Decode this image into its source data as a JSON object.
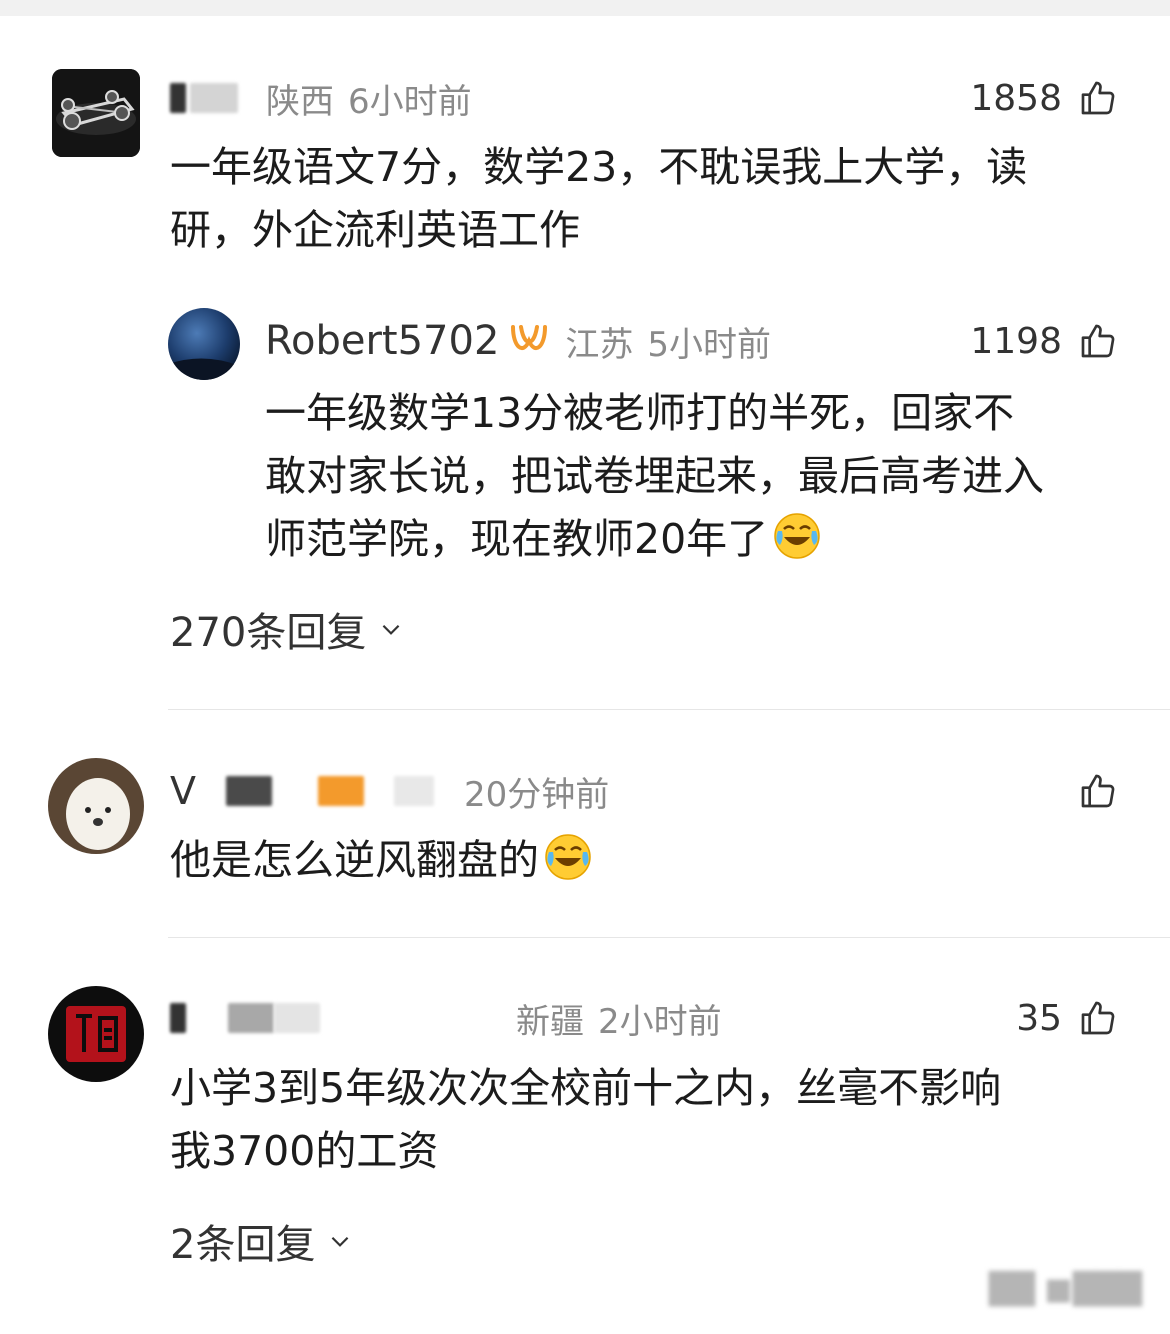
{
  "comments": [
    {
      "user_prefix": "",
      "location": "陕西",
      "time": "6小时前",
      "likes": "1858",
      "text_lines": [
        "一年级语文7分，数学23，不耽误我上大学，读",
        "研，外企流利英语工作"
      ],
      "reply": {
        "user": "Robert5702",
        "location": "江苏",
        "time": "5小时前",
        "likes": "1198",
        "text_lines": [
          "一年级数学13分被老师打的半死，回家不",
          "敢对家长说，把试卷埋起来，最后高考进入",
          "师范学院，现在教师20年了"
        ],
        "emoji": "face-with-tears-of-joy"
      },
      "replies_label": "270条回复"
    },
    {
      "user_prefix": "V",
      "location": "",
      "time": "20分钟前",
      "likes": "",
      "text_lines": [
        "他是怎么逆风翻盘的"
      ],
      "emoji": "face-with-tears-of-joy"
    },
    {
      "user_prefix": "",
      "location": "新疆",
      "time": "2小时前",
      "likes": "35",
      "text_lines": [
        "小学3到5年级次次全校前十之内，丝毫不影响",
        "我3700的工资"
      ],
      "replies_label": "2条回复"
    }
  ],
  "colors": {
    "accent_vip": "#f39a2c",
    "meta_gray": "#8a8a8a",
    "text": "#1c1c1c",
    "divider": "#e6e6e6"
  },
  "icons": [
    "thumbs-up-icon",
    "chevron-down-icon",
    "vip-badge-icon",
    "face-with-tears-of-joy"
  ]
}
